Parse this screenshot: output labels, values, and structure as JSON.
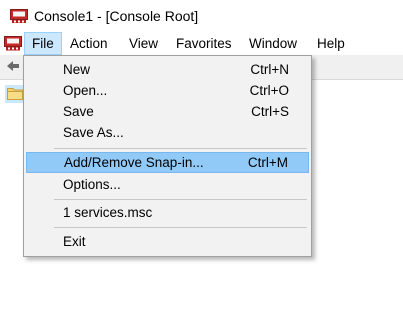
{
  "window": {
    "title": "Console1 - [Console Root]"
  },
  "menubar": {
    "items": [
      {
        "label": "File",
        "active": true
      },
      {
        "label": "Action",
        "active": false
      },
      {
        "label": "View",
        "active": false
      },
      {
        "label": "Favorites",
        "active": false
      },
      {
        "label": "Window",
        "active": false
      },
      {
        "label": "Help",
        "active": false
      }
    ]
  },
  "file_menu": {
    "items": [
      {
        "label": "New",
        "shortcut": "Ctrl+N"
      },
      {
        "label": "Open...",
        "shortcut": "Ctrl+O"
      },
      {
        "label": "Save",
        "shortcut": "Ctrl+S"
      },
      {
        "label": "Save As...",
        "shortcut": ""
      },
      {
        "label": "Add/Remove Snap-in...",
        "shortcut": "Ctrl+M",
        "highlighted": true
      },
      {
        "label": "Options...",
        "shortcut": ""
      },
      {
        "label": "1 services.msc",
        "shortcut": ""
      },
      {
        "label": "Exit",
        "shortcut": ""
      }
    ]
  },
  "icons": {
    "app": "mmc-console-icon",
    "menu": "mmc-console-icon",
    "back": "back-arrow-icon",
    "tree_root": "folder-icon"
  },
  "colors": {
    "highlight": "#91c9f7",
    "menu_active": "#cce8ff",
    "menu_bg": "#f2f2f2"
  }
}
